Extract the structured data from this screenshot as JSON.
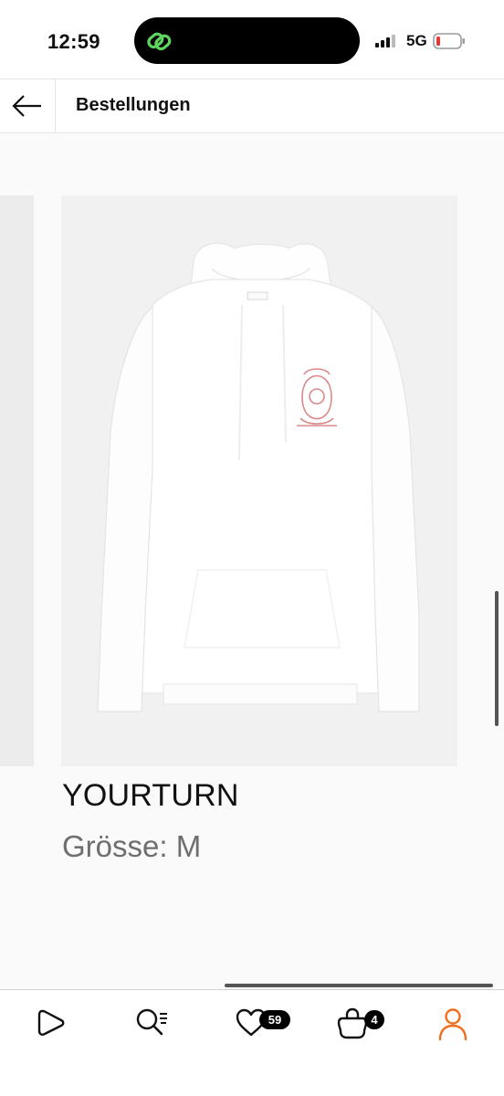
{
  "status_bar": {
    "time": "12:59",
    "network": "5G",
    "island_icon": "link-app-icon",
    "signal_icon": "signal-bars-icon",
    "battery_icon": "battery-low-icon"
  },
  "header": {
    "title": "Bestellungen",
    "back_icon": "arrow-left-icon"
  },
  "product": {
    "brand": "YOURTURN",
    "size": "Grösse: M",
    "image": "white-hoodie-image"
  },
  "nav": {
    "items": [
      {
        "icon": "play-icon"
      },
      {
        "icon": "search-icon"
      },
      {
        "icon": "heart-icon",
        "badge": "59"
      },
      {
        "icon": "shopping-bag-icon",
        "badge": "4"
      },
      {
        "icon": "profile-icon",
        "active": true
      }
    ]
  },
  "colors": {
    "accent": "#f06f1c",
    "island_icon": "#5ed35e",
    "battery_low": "#e53935"
  }
}
